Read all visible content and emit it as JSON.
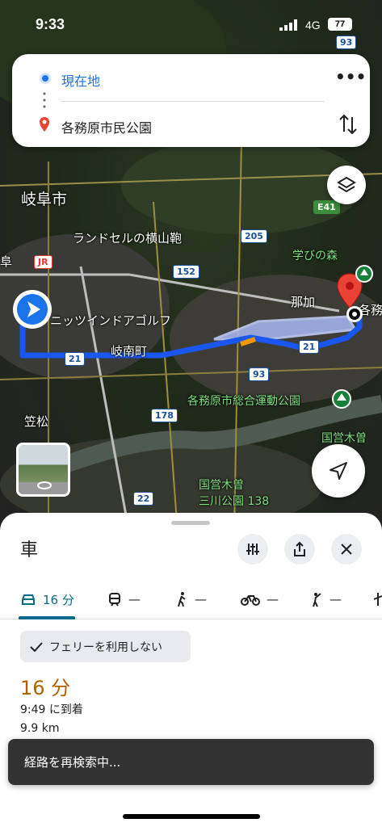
{
  "status_bar": {
    "time": "9:33",
    "network": "4G",
    "battery": "77"
  },
  "directions": {
    "origin": "現在地",
    "destination": "各務原市民公園",
    "more_icon": "more-horizontal-icon",
    "swap_icon": "swap-vertical-icon"
  },
  "map": {
    "labels": {
      "gifu_city": "岐阜市",
      "randsel": "ランドセルの横山鞄",
      "nitsutsu": "ニッツインドアゴルフ",
      "ginan": "岐南町",
      "manabi": "学びの森",
      "naka": "那加",
      "kakamigahara": "各務原",
      "sports_park": "各務原市総合運動公園",
      "kasamatsu": "笠松",
      "kokuei_kiso": "国営木曽",
      "kokuei_kiso2": "国営木曽",
      "sansen": "三川公園 138",
      "gifu_edge": "阜",
      "jr": "JR"
    },
    "road_numbers": {
      "r93_top": "93",
      "r205": "205",
      "r152": "152",
      "e41": "E41",
      "r21_a": "21",
      "r21_b": "21",
      "r93": "93",
      "r178": "178",
      "r22": "22"
    }
  },
  "sheet": {
    "mode_title": "車",
    "tabs": [
      {
        "label": "16 分",
        "icon": "car-icon"
      },
      {
        "label": "—",
        "icon": "train-icon"
      },
      {
        "label": "—",
        "icon": "walk-icon"
      },
      {
        "label": "—",
        "icon": "bike-icon"
      },
      {
        "label": "—",
        "icon": "rideshare-icon"
      }
    ],
    "ferry_chip": "フェリーを利用しない",
    "duration": "16 分",
    "arrival": "9:49 に到着",
    "distance": "9.9 km"
  },
  "toast": "経路を再検索中...",
  "colors": {
    "route": "#1a56f0",
    "accent": "#0b6b8e",
    "duration": "#b06000",
    "pin": "#ea4335"
  }
}
